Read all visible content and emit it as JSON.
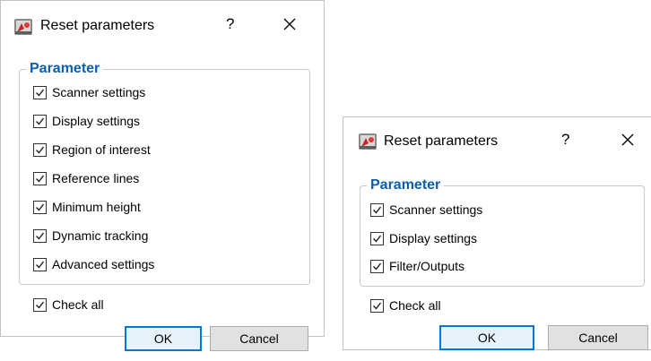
{
  "dialogs": [
    {
      "title": "Reset parameters",
      "help_glyph": "?",
      "close_glyph": "close",
      "group_title": "Parameter",
      "options": [
        {
          "label": "Scanner settings",
          "checked": true
        },
        {
          "label": "Display settings",
          "checked": true
        },
        {
          "label": "Region of interest",
          "checked": true
        },
        {
          "label": "Reference lines",
          "checked": true
        },
        {
          "label": "Minimum height",
          "checked": true
        },
        {
          "label": "Dynamic tracking",
          "checked": true
        },
        {
          "label": "Advanced settings",
          "checked": true
        }
      ],
      "check_all": {
        "label": "Check all",
        "checked": true
      },
      "ok_label": "OK",
      "cancel_label": "Cancel"
    },
    {
      "title": "Reset parameters",
      "help_glyph": "?",
      "close_glyph": "close",
      "group_title": "Parameter",
      "options": [
        {
          "label": "Scanner settings",
          "checked": true
        },
        {
          "label": "Display settings",
          "checked": true
        },
        {
          "label": "Filter/Outputs",
          "checked": true
        }
      ],
      "check_all": {
        "label": "Check all",
        "checked": true
      },
      "ok_label": "OK",
      "cancel_label": "Cancel"
    }
  ],
  "colors": {
    "group_title": "#0b5fad",
    "default_button_border": "#0078d7",
    "default_button_fill": "#e5f1fb",
    "button_fill": "#e1e1e1"
  },
  "icons": {
    "app": "scanner-app-icon",
    "help": "help-icon",
    "close": "close-icon",
    "check": "checkmark-icon"
  }
}
